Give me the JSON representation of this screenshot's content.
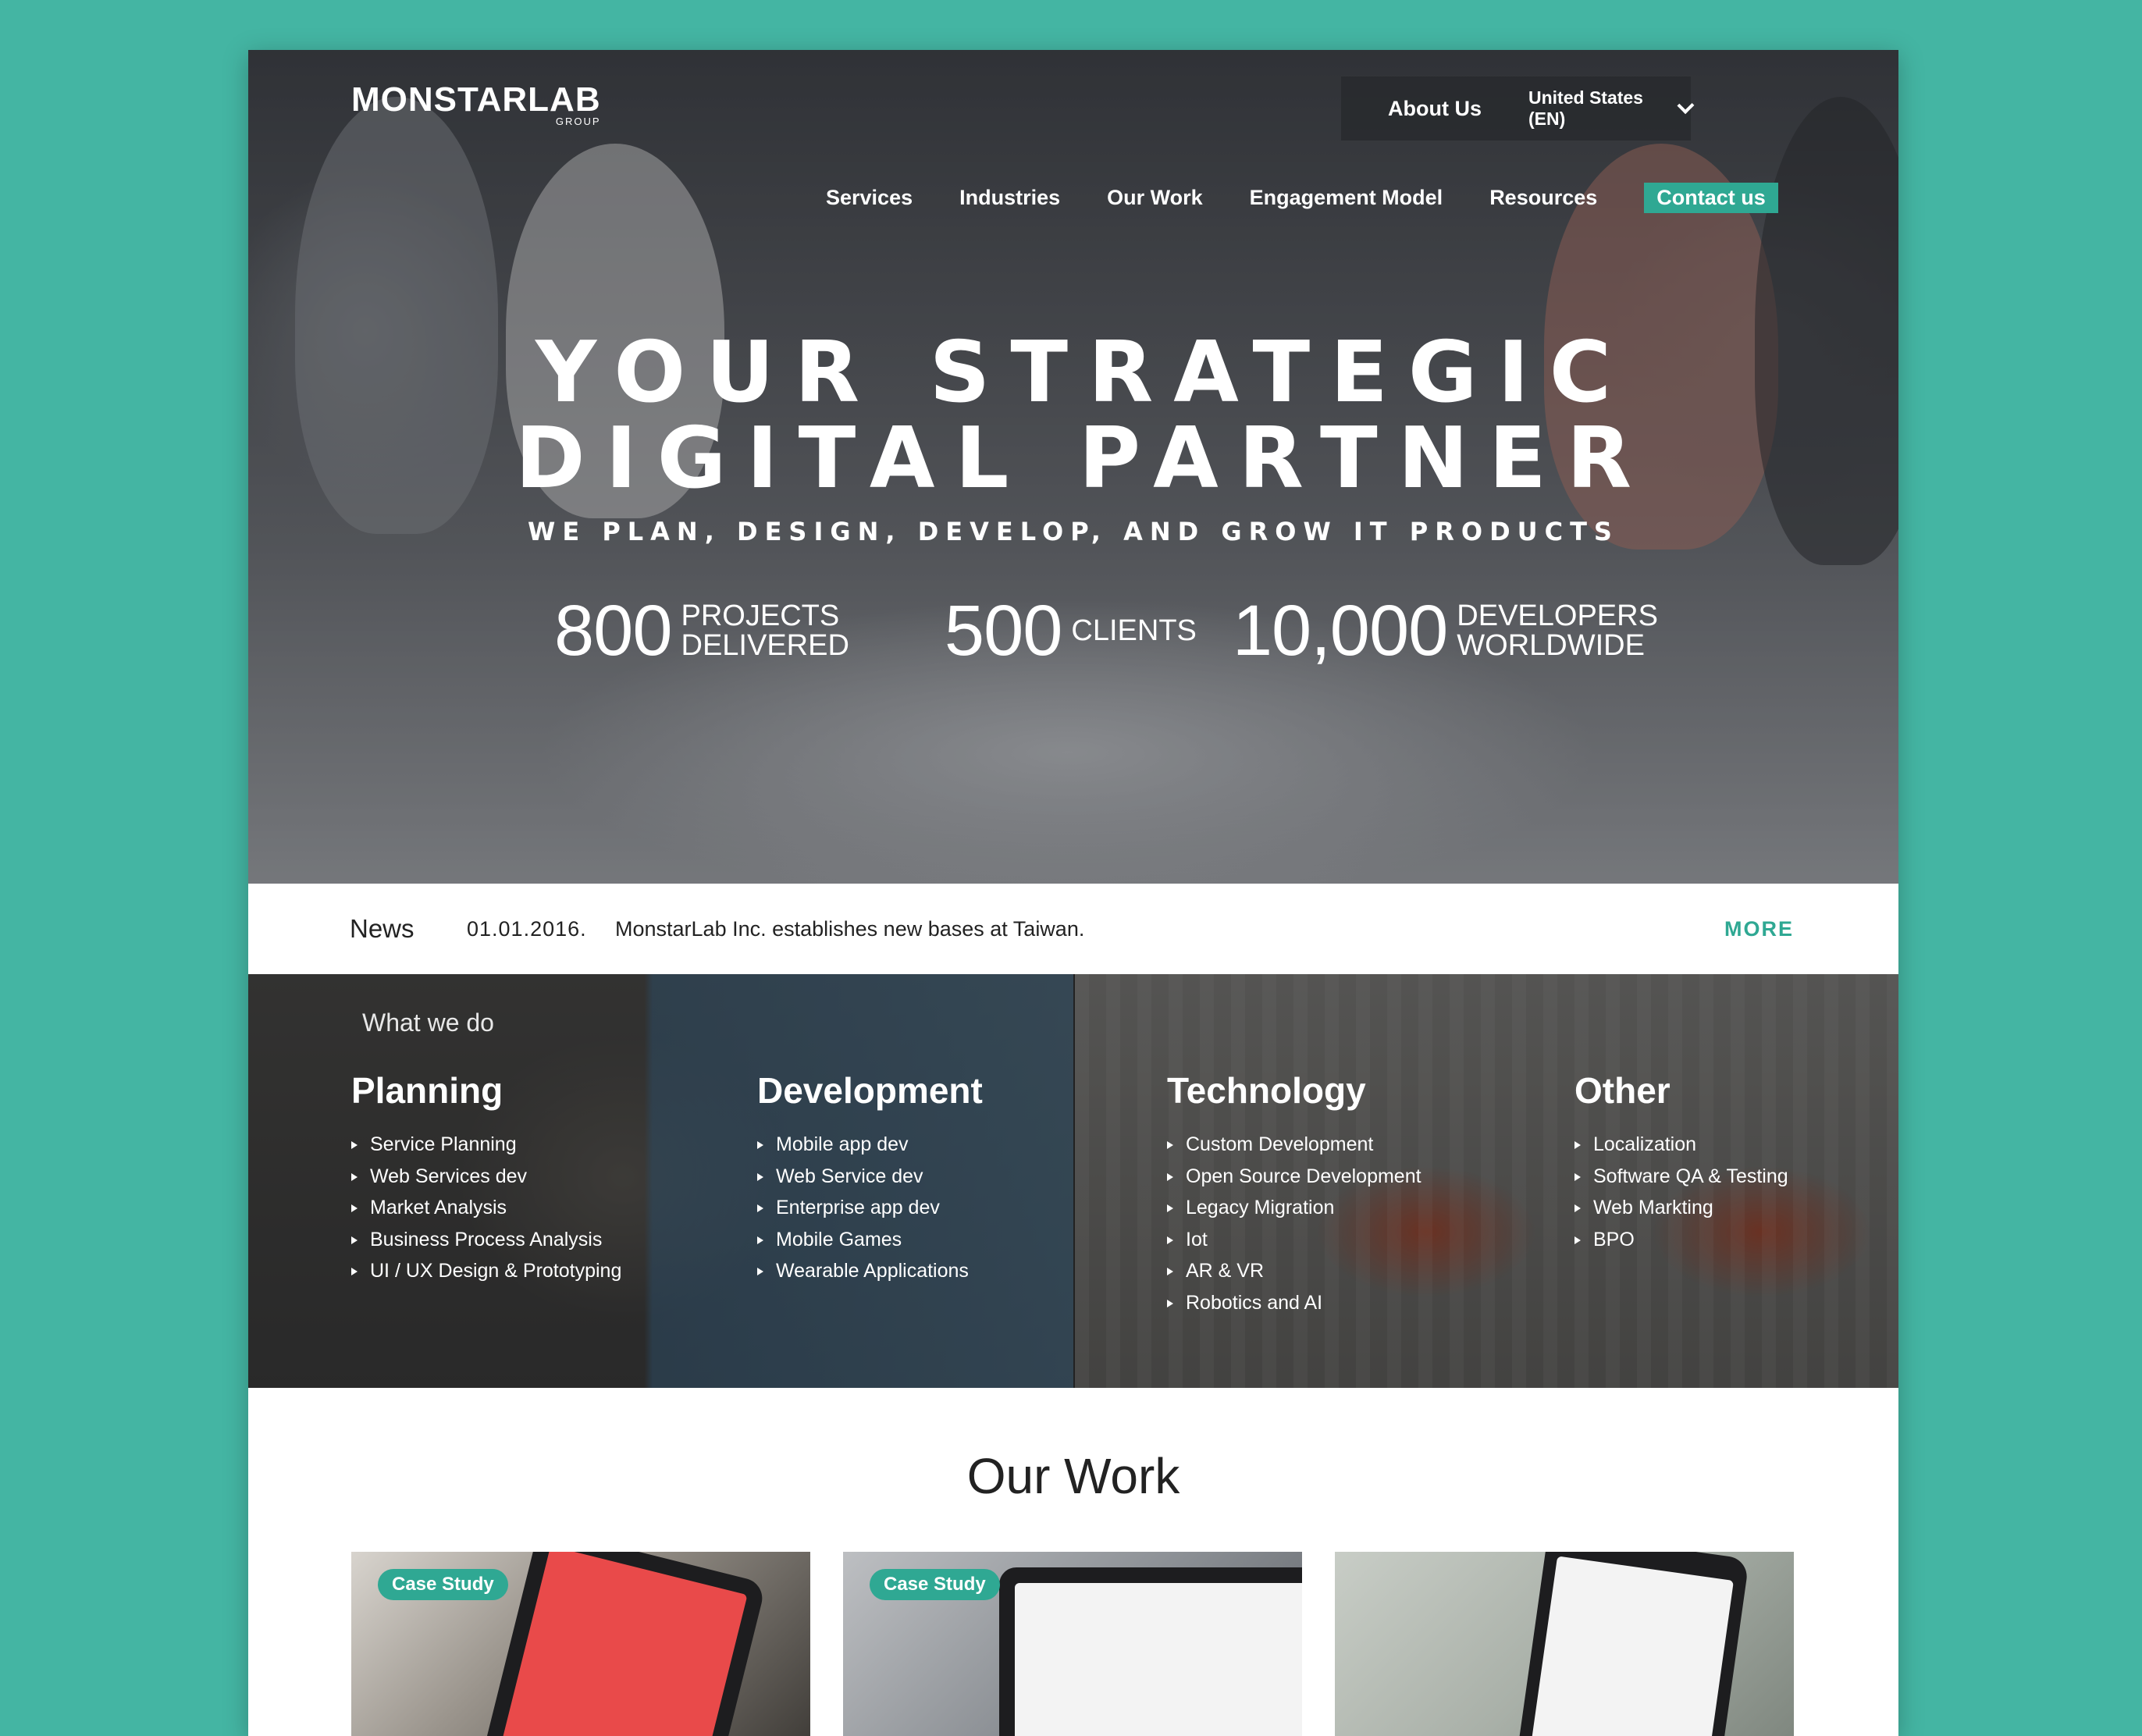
{
  "brand": {
    "logo": "MONSTARLAB",
    "logo_sub": "GROUP"
  },
  "topbar": {
    "about": "About Us",
    "region": "United States (EN)"
  },
  "nav": {
    "items": [
      "Services",
      "Industries",
      "Our Work",
      "Engagement Model",
      "Resources"
    ],
    "contact": "Contact us"
  },
  "hero": {
    "headline_line1": "YOUR STRATEGIC",
    "headline_line2": "DIGITAL PARTNER",
    "tagline": "WE PLAN, DESIGN, DEVELOP, AND GROW IT PRODUCTS",
    "stats": [
      {
        "number": "800",
        "label_line1": "PROJECTS",
        "label_line2": "DELIVERED"
      },
      {
        "number": "500",
        "label_line1": "CLIENTS",
        "label_line2": ""
      },
      {
        "number": "10,000",
        "label_line1": "DEVELOPERS",
        "label_line2": "WORLDWIDE"
      }
    ]
  },
  "news": {
    "title": "News",
    "date": "01.01.2016.",
    "text": "MonstarLab Inc. establishes new bases at Taiwan.",
    "more": "MORE"
  },
  "what_we_do": {
    "label": "What we do",
    "columns": [
      {
        "title": "Planning",
        "items": [
          "Service Planning",
          "Web Services dev",
          "Market Analysis",
          "Business Process Analysis",
          "UI / UX Design & Prototyping"
        ]
      },
      {
        "title": "Development",
        "items": [
          "Mobile app dev",
          "Web Service dev",
          "Enterprise app dev",
          "Mobile Games",
          "Wearable Applications"
        ]
      },
      {
        "title": "Technology",
        "items": [
          "Custom Development",
          "Open Source Development",
          "Legacy Migration",
          "Iot",
          "AR & VR",
          "Robotics and AI"
        ]
      },
      {
        "title": "Other",
        "items": [
          "Localization",
          "Software QA & Testing",
          "Web Markting",
          "BPO"
        ]
      }
    ]
  },
  "our_work": {
    "title": "Our Work",
    "cards": [
      {
        "badge": "Case Study"
      },
      {
        "badge": "Case Study"
      },
      {
        "badge": ""
      }
    ]
  },
  "colors": {
    "background": "#44b5a3",
    "accent": "#2fa893",
    "panel_text": "#ffffff"
  }
}
